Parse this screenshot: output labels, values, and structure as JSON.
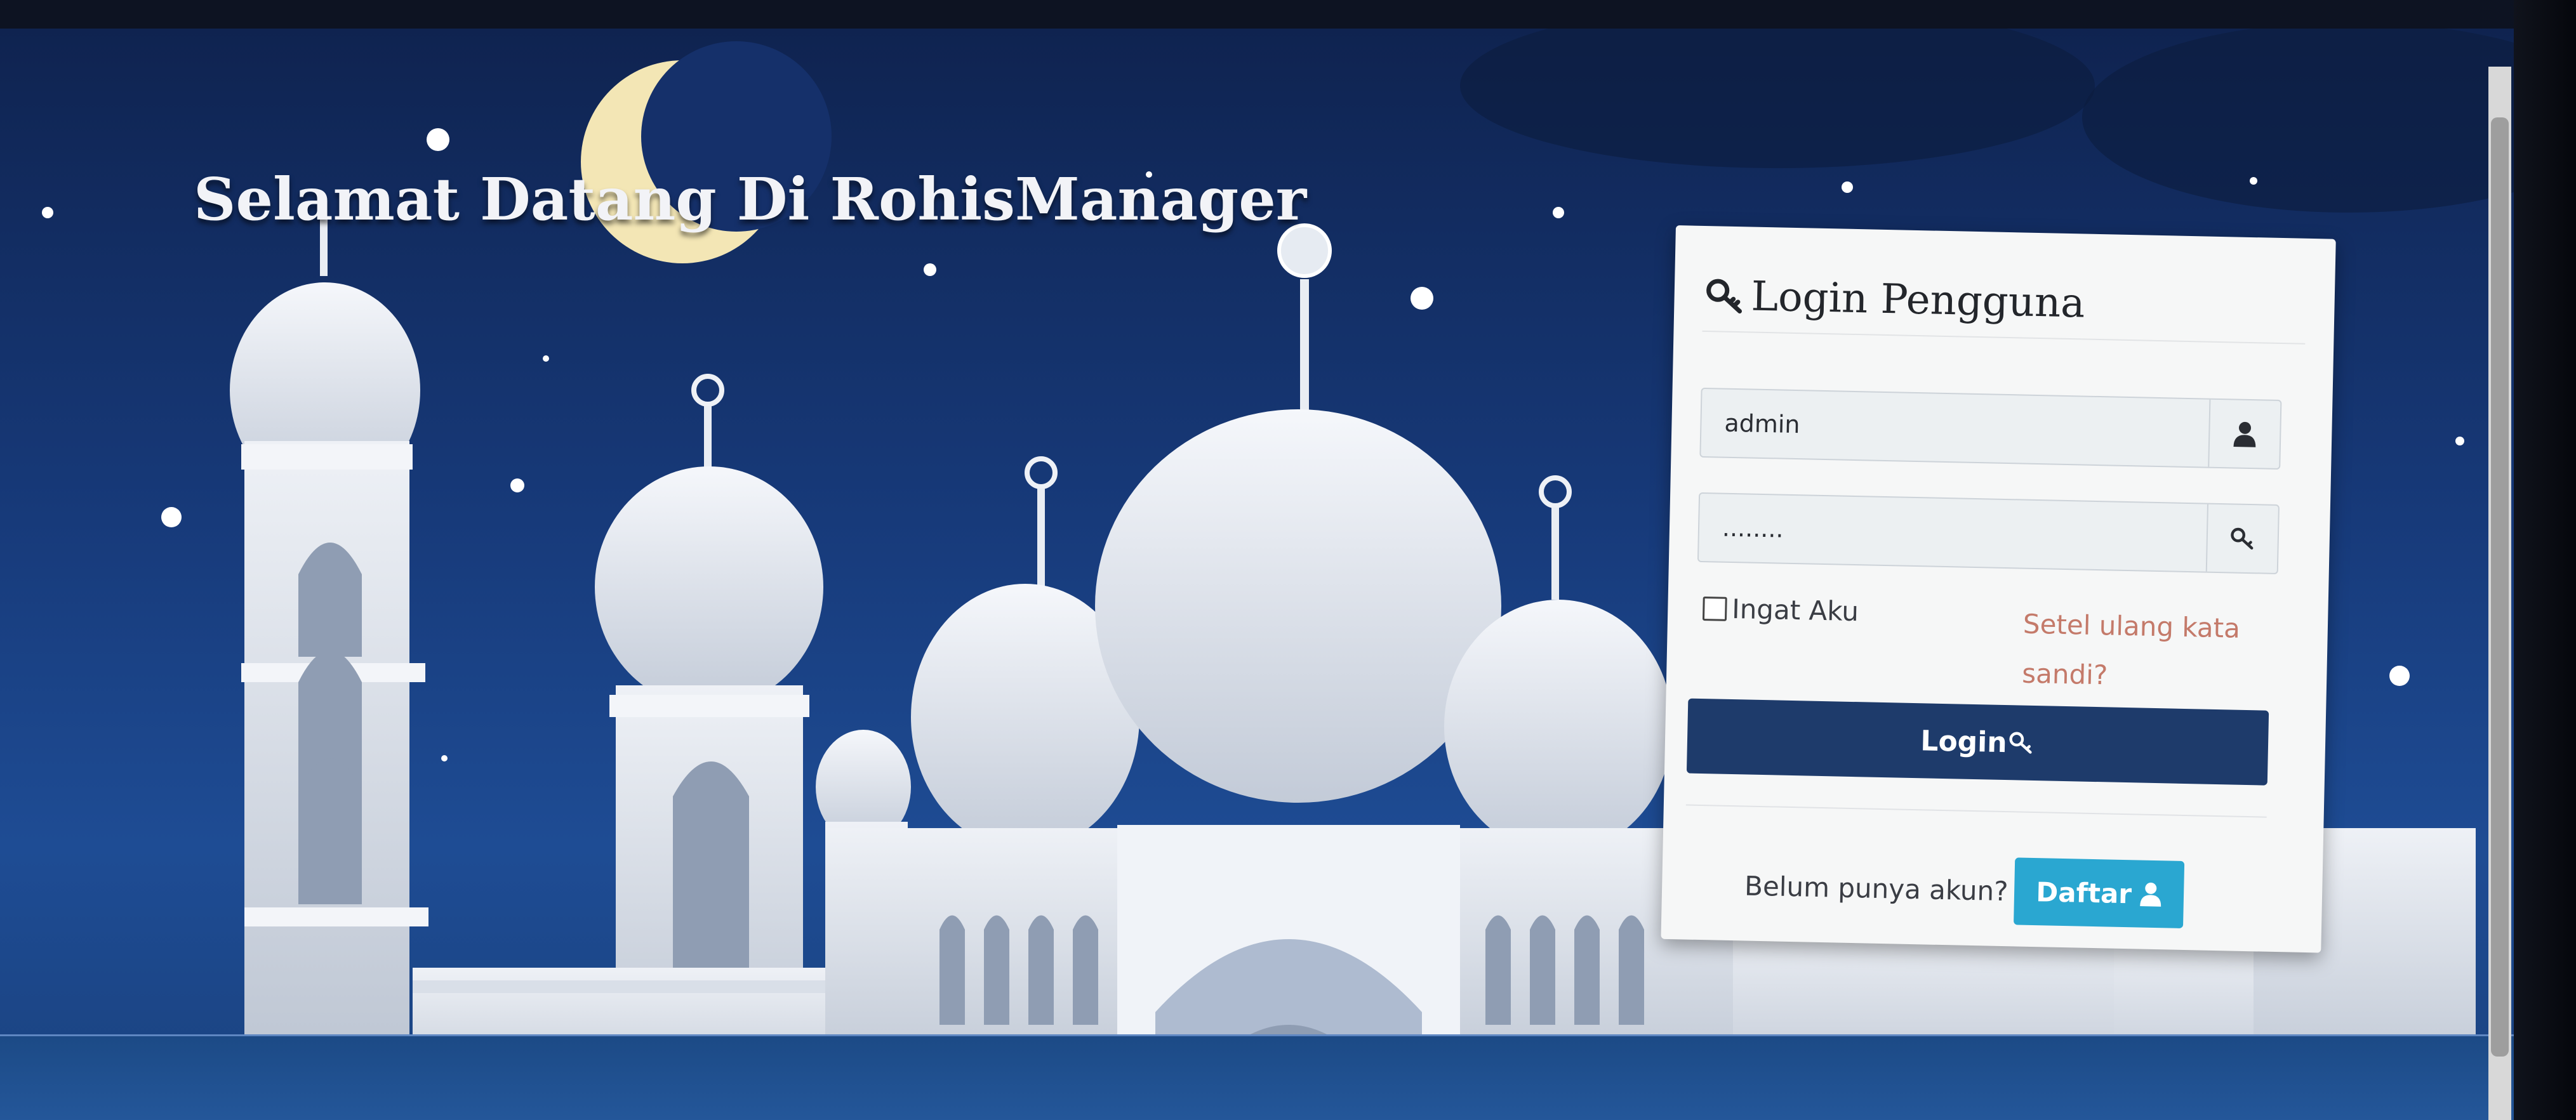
{
  "page": {
    "welcome_title": "Selamat Datang Di RohisManager"
  },
  "login": {
    "title": "Login Pengguna",
    "username_value": "admin",
    "password_value": "........",
    "remember_label": "Ingat Aku",
    "forgot_label": "Setel ulang kata sandi?",
    "login_button": "Login",
    "signup_prompt": "Belum punya akun?",
    "signup_button": "Daftar"
  },
  "colors": {
    "background": "#173a7a",
    "card": "#f6f7f7",
    "login_button": "#1e3b6b",
    "daftar_button": "#2aa7d1",
    "forgot_link": "#c47a6a"
  },
  "icons": {
    "title_icon": "key-icon",
    "username_addon": "user-icon",
    "password_addon": "key-icon",
    "login_button_icon": "key-icon",
    "daftar_button_icon": "user-icon"
  }
}
